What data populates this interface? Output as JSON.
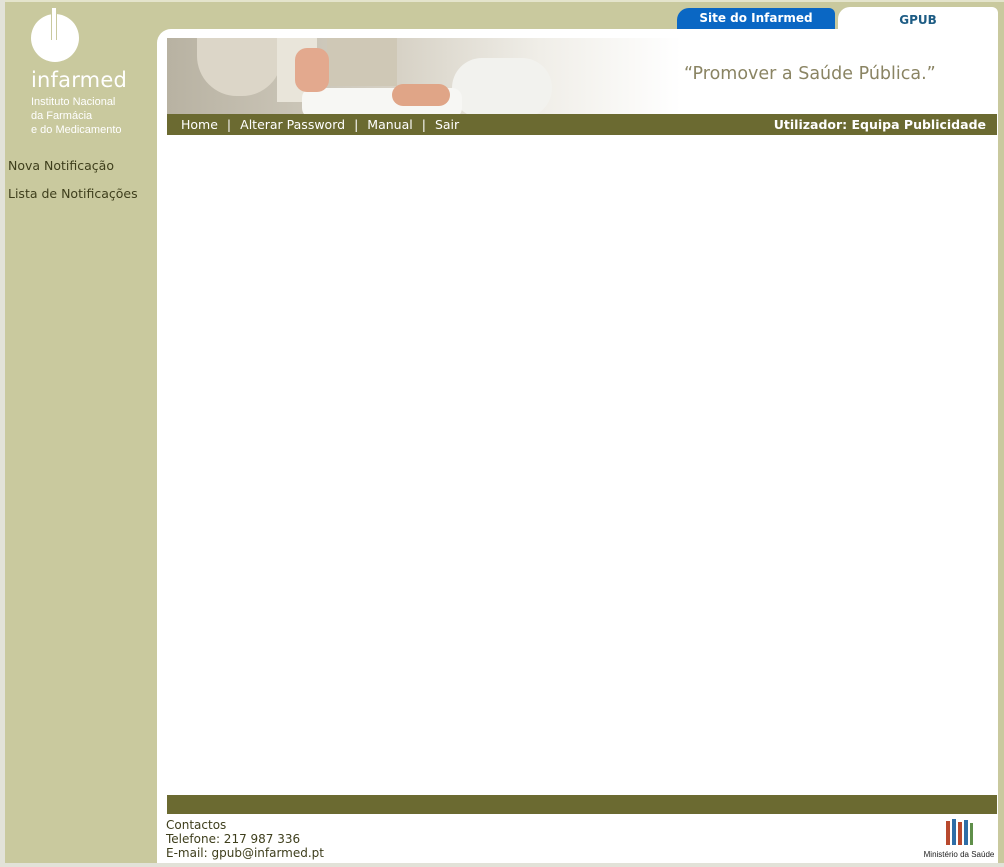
{
  "logo": {
    "wordmark": "infarmed",
    "subtitle_lines": [
      "Instituto Nacional",
      "da Farmácia",
      "e do Medicamento"
    ]
  },
  "sidebar": {
    "items": [
      {
        "label": "Nova Notificação"
      },
      {
        "label": "Lista de Notificações"
      }
    ]
  },
  "tabs": {
    "site": "Site do Infarmed",
    "gpub": "GPUB"
  },
  "banner": {
    "slogan": "“Promover a Saúde Pública.”"
  },
  "nav": {
    "home": "Home",
    "password": "Alterar Password",
    "manual": "Manual",
    "exit": "Sair",
    "separator": "|",
    "user": "Utilizador: Equipa Publicidade"
  },
  "footer": {
    "contacts_title": "Contactos",
    "phone": "Telefone: 217 987 336",
    "email": "E-mail: gpub@infarmed.pt",
    "ministry": "Ministério da Saúde"
  },
  "colors": {
    "sidebar_bg": "#c9c99e",
    "nav_bar": "#6b6a31",
    "tab_site": "#0a67c4",
    "tab_gpub_text": "#1d5c84"
  }
}
